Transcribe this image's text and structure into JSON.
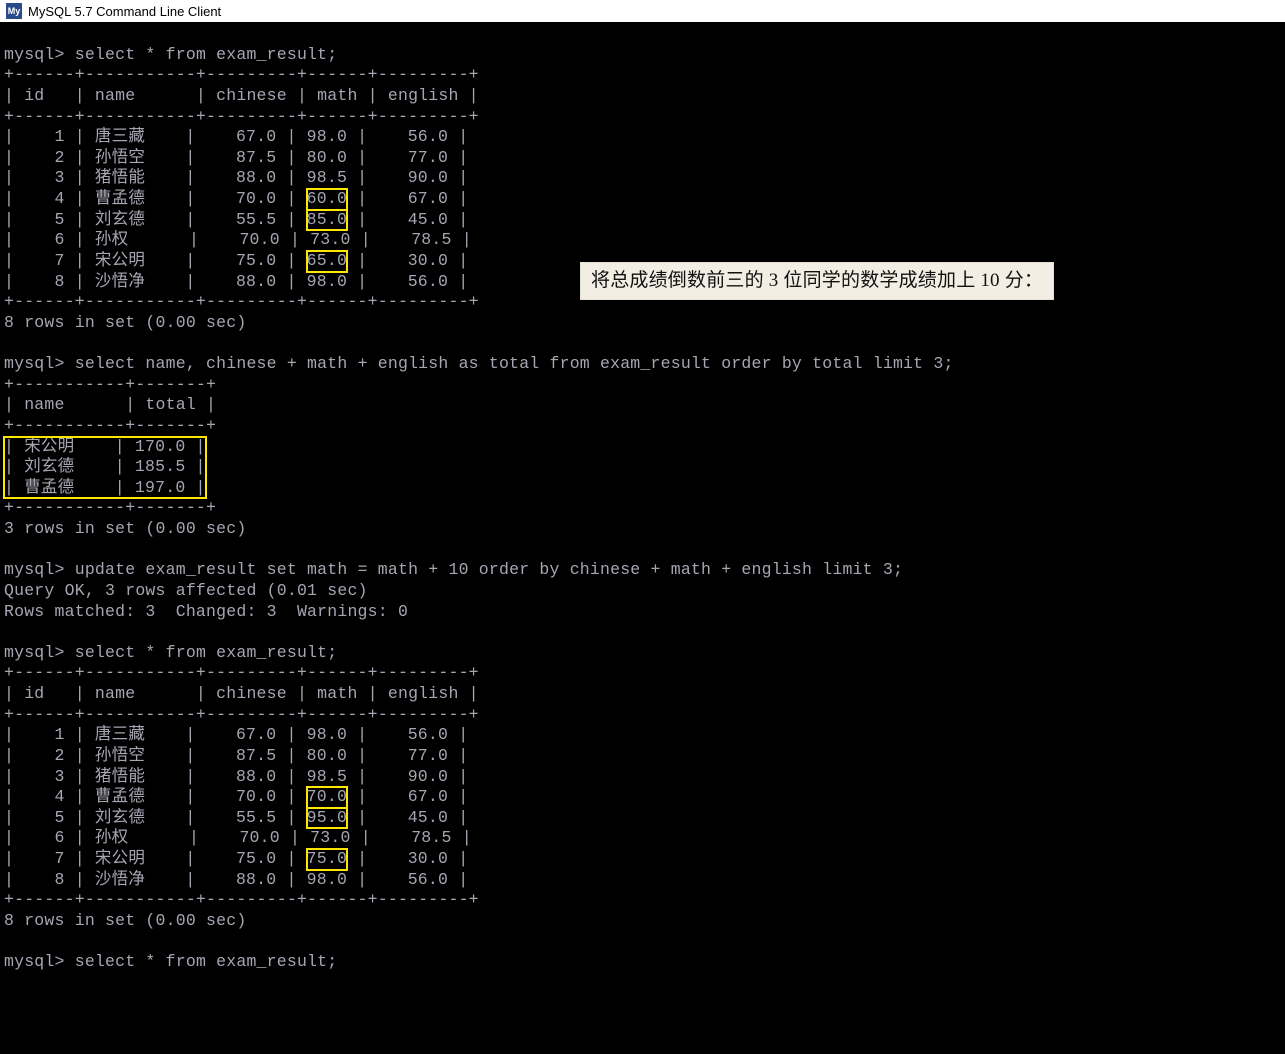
{
  "window": {
    "title": "MySQL 5.7 Command Line Client",
    "icon_name": "mysql-icon",
    "icon_text": "My"
  },
  "annotation": {
    "text": "将总成绩倒数前三的 3 位同学的数学成绩加上 10 分："
  },
  "blocks": {
    "q1_prompt": "mysql> ",
    "q1_cmd": "select * from exam_result;",
    "t1": {
      "sep": "+------+-----------+---------+------+---------+",
      "head": "| id   | name      | chinese | math | english |",
      "rows": [
        {
          "id": "1",
          "name": "唐三藏",
          "chinese": "67.0",
          "math": "98.0",
          "english": "56.0",
          "hl": false
        },
        {
          "id": "2",
          "name": "孙悟空",
          "chinese": "87.5",
          "math": "80.0",
          "english": "77.0",
          "hl": false
        },
        {
          "id": "3",
          "name": "猪悟能",
          "chinese": "88.0",
          "math": "98.5",
          "english": "90.0",
          "hl": false
        },
        {
          "id": "4",
          "name": "曹孟德",
          "chinese": "70.0",
          "math": "60.0",
          "english": "67.0",
          "hl": true
        },
        {
          "id": "5",
          "name": "刘玄德",
          "chinese": "55.5",
          "math": "85.0",
          "english": "45.0",
          "hl": true
        },
        {
          "id": "6",
          "name": "孙权  ",
          "chinese": "70.0",
          "math": "73.0",
          "english": "78.5",
          "hl": false
        },
        {
          "id": "7",
          "name": "宋公明",
          "chinese": "75.0",
          "math": "65.0",
          "english": "30.0",
          "hl": true
        },
        {
          "id": "8",
          "name": "沙悟净",
          "chinese": "88.0",
          "math": "98.0",
          "english": "56.0",
          "hl": false
        }
      ],
      "footer": "8 rows in set (0.00 sec)"
    },
    "q2_prompt": "mysql> ",
    "q2_cmd": "select name, chinese + math + english as total from exam_result order by total limit 3;",
    "t2": {
      "sep": "+-----------+-------+",
      "head": "| name      | total |",
      "rows": [
        {
          "name": "宋公明",
          "total": "170.0"
        },
        {
          "name": "刘玄德",
          "total": "185.5"
        },
        {
          "name": "曹孟德",
          "total": "197.0"
        }
      ],
      "footer": "3 rows in set (0.00 sec)"
    },
    "q3_prompt": "mysql> ",
    "q3_cmd": "update exam_result set math = math + 10 order by chinese + math + english limit 3;",
    "q3_res1": "Query OK, 3 rows affected (0.01 sec)",
    "q3_res2": "Rows matched: 3  Changed: 3  Warnings: 0",
    "q4_prompt": "mysql> ",
    "q4_cmd": "select * from exam_result;",
    "t3": {
      "sep": "+------+-----------+---------+------+---------+",
      "head": "| id   | name      | chinese | math | english |",
      "rows": [
        {
          "id": "1",
          "name": "唐三藏",
          "chinese": "67.0",
          "math": "98.0",
          "english": "56.0",
          "hl": false
        },
        {
          "id": "2",
          "name": "孙悟空",
          "chinese": "87.5",
          "math": "80.0",
          "english": "77.0",
          "hl": false
        },
        {
          "id": "3",
          "name": "猪悟能",
          "chinese": "88.0",
          "math": "98.5",
          "english": "90.0",
          "hl": false
        },
        {
          "id": "4",
          "name": "曹孟德",
          "chinese": "70.0",
          "math": "70.0",
          "english": "67.0",
          "hl": true
        },
        {
          "id": "5",
          "name": "刘玄德",
          "chinese": "55.5",
          "math": "95.0",
          "english": "45.0",
          "hl": true
        },
        {
          "id": "6",
          "name": "孙权  ",
          "chinese": "70.0",
          "math": "73.0",
          "english": "78.5",
          "hl": false
        },
        {
          "id": "7",
          "name": "宋公明",
          "chinese": "75.0",
          "math": "75.0",
          "english": "30.0",
          "hl": true
        },
        {
          "id": "8",
          "name": "沙悟净",
          "chinese": "88.0",
          "math": "98.0",
          "english": "56.0",
          "hl": false
        }
      ],
      "footer": "8 rows in set (0.00 sec)"
    },
    "q5_prompt": "mysql> ",
    "q5_cmd": "select * from exam_result;"
  }
}
